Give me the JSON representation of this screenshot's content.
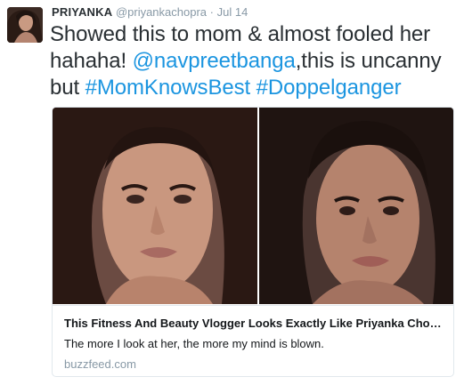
{
  "tweet": {
    "author_name": "PRIYANKA",
    "author_handle": "@priyankachopra",
    "separator": "·",
    "timestamp": "Jul 14",
    "text_part1": "Showed this to mom & almost fooled her hahaha! ",
    "mention": "@navpreetbanga",
    "text_part2": ",this is uncanny but ",
    "hashtag1": "#MomKnowsBest",
    "hashtag2": "#Doppelganger"
  },
  "card": {
    "left_photo_desc": "woman with long dark hair, close-up portrait",
    "right_photo_desc": "woman with dark tousled hair, close-up portrait",
    "title": "This Fitness And Beauty Vlogger Looks Exactly Like Priyanka Chopra",
    "description": "The more I look at her, the more my mind is blown.",
    "domain": "buzzfeed.com"
  },
  "colors": {
    "link": "#1b95e0",
    "text": "#292f33",
    "muted": "#8899a6",
    "border": "#e1e8ed"
  }
}
